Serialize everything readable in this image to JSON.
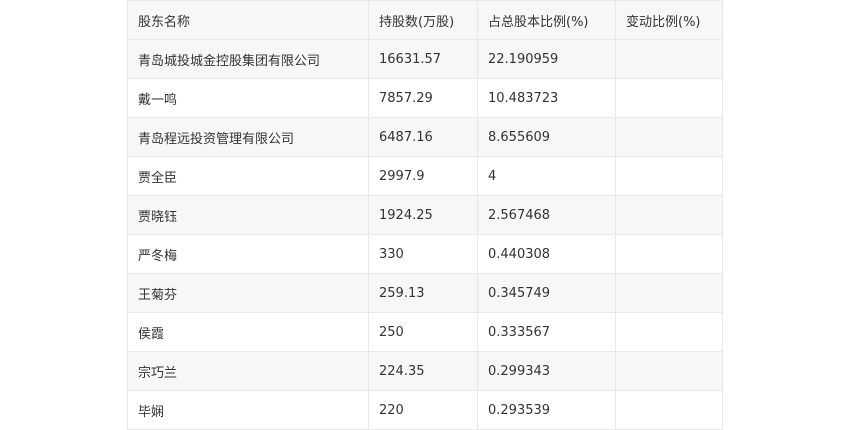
{
  "table": {
    "headers": [
      "股东名称",
      "持股数(万股)",
      "占总股本比例(%)",
      "变动比例(%)"
    ],
    "rows": [
      [
        "青岛城投城金控股集团有限公司",
        "16631.57",
        "22.190959",
        ""
      ],
      [
        "戴一鸣",
        "7857.29",
        "10.483723",
        ""
      ],
      [
        "青岛程远投资管理有限公司",
        "6487.16",
        "8.655609",
        ""
      ],
      [
        "贾全臣",
        "2997.9",
        "4",
        ""
      ],
      [
        "贾晓钰",
        "1924.25",
        "2.567468",
        ""
      ],
      [
        "严冬梅",
        "330",
        "0.440308",
        ""
      ],
      [
        "王菊芬",
        "259.13",
        "0.345749",
        ""
      ],
      [
        "侯霞",
        "250",
        "0.333567",
        ""
      ],
      [
        "宗巧兰",
        "224.35",
        "0.299343",
        ""
      ],
      [
        "毕娴",
        "220",
        "0.293539",
        ""
      ]
    ]
  }
}
